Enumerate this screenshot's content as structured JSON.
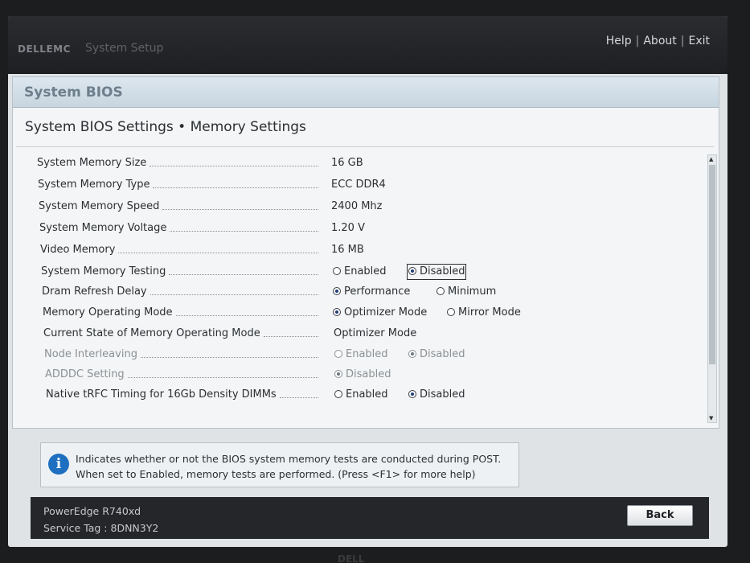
{
  "header": {
    "logo": "DELLEMC",
    "app_title": "System Setup",
    "links": [
      "Help",
      "About",
      "Exit"
    ]
  },
  "section": {
    "title": "System BIOS"
  },
  "page": {
    "title": "System BIOS Settings • Memory Settings"
  },
  "settings": [
    {
      "label": "System Memory Size",
      "value": "16 GB"
    },
    {
      "label": "System Memory Type",
      "value": "ECC DDR4"
    },
    {
      "label": "System Memory Speed",
      "value": "2400 Mhz"
    },
    {
      "label": "System Memory Voltage",
      "value": "1.20 V"
    },
    {
      "label": "Video Memory",
      "value": "16 MB"
    },
    {
      "label": "System Memory Testing",
      "options": [
        "Enabled",
        "Disabled"
      ],
      "selected": "Disabled"
    },
    {
      "label": "Dram Refresh Delay",
      "options": [
        "Performance",
        "Minimum"
      ],
      "selected": "Performance"
    },
    {
      "label": "Memory Operating Mode",
      "options": [
        "Optimizer Mode",
        "Mirror Mode"
      ],
      "selected": "Optimizer Mode"
    },
    {
      "label": "Current State of Memory Operating Mode",
      "value": "Optimizer Mode"
    },
    {
      "label": "Node Interleaving",
      "options": [
        "Enabled",
        "Disabled"
      ],
      "selected": "Disabled",
      "disabled": true
    },
    {
      "label": "ADDDC Setting",
      "options": [
        "Disabled"
      ],
      "selected": "Disabled",
      "disabled": true
    },
    {
      "label": "Native tRFC Timing for 16Gb Density DIMMs",
      "options": [
        "Enabled",
        "Disabled"
      ],
      "selected": "Disabled"
    }
  ],
  "help": {
    "line1": "Indicates whether or not the BIOS system memory tests are conducted during POST.",
    "line2": "When set to Enabled, memory tests are performed. (Press <F1> for more help)"
  },
  "footer": {
    "model": "PowerEdge R740xd",
    "service_tag": "Service Tag : 8DNN3Y2",
    "back_label": "Back"
  },
  "bezel": {
    "logo": "DELL"
  },
  "colors": {
    "accent": "#1e6fc0",
    "topbar": "#1d1f22",
    "panel": "#f3f5f6"
  }
}
